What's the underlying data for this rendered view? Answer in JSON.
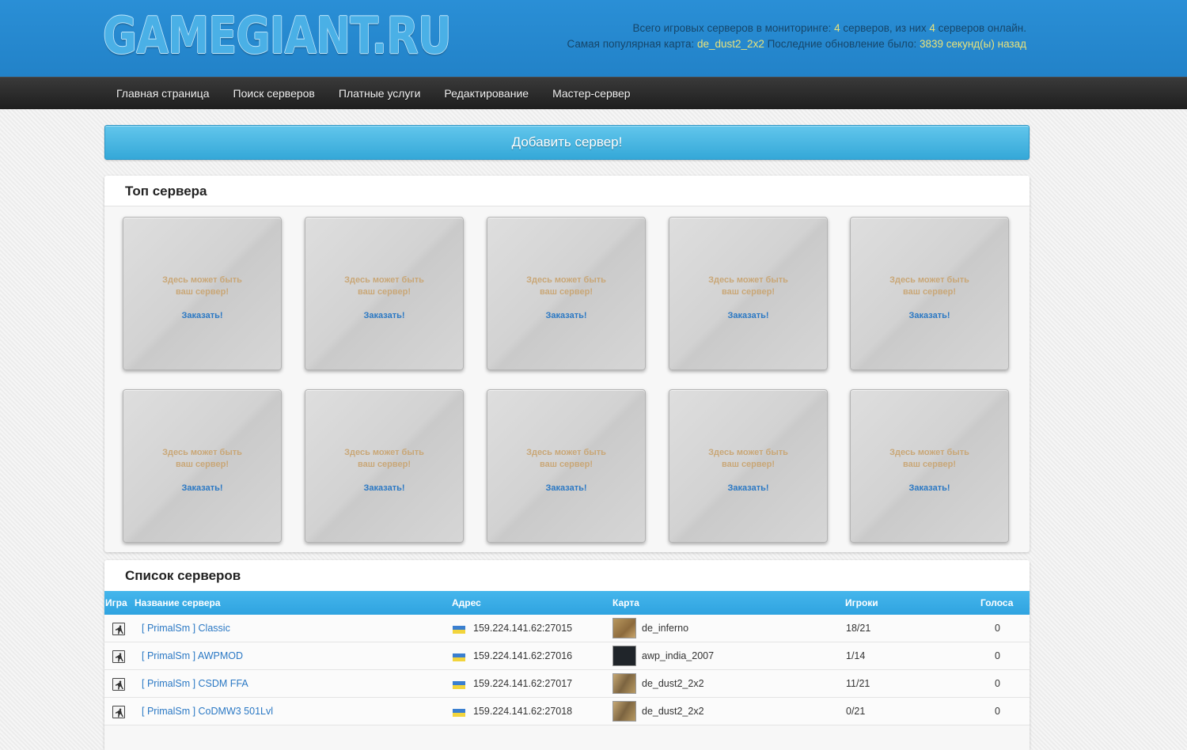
{
  "header": {
    "logo": "GAMEGIANT.RU",
    "stats": {
      "line1_prefix": "Всего игровых серверов в мониторинге:",
      "total": "4",
      "line1_mid": "серверов, из них",
      "online": "4",
      "line1_suffix": "серверов онлайн.",
      "line2_prefix": "Самая популярная карта:",
      "popular_map": "de_dust2_2x2",
      "line2_mid": "Последние обновление было:",
      "last_update": "3839 секунд(ы) назад"
    }
  },
  "nav": {
    "items": [
      {
        "label": "Главная страница"
      },
      {
        "label": "Поиск серверов"
      },
      {
        "label": "Платные услуги"
      },
      {
        "label": "Редактирование"
      },
      {
        "label": "Мастер-сервер"
      }
    ]
  },
  "add_server_label": "Добавить сервер!",
  "top_servers": {
    "title": "Топ сервера",
    "slot_line1": "Здесь может быть",
    "slot_line2": "ваш сервер!",
    "slot_order": "Заказать!",
    "slot_count": 10
  },
  "server_list": {
    "title": "Список серверов",
    "columns": {
      "game": "Игра",
      "name": "Название сервера",
      "address": "Адрес",
      "map": "Карта",
      "players": "Игроки",
      "votes": "Голоса"
    },
    "rows": [
      {
        "game_icon": "counter-strike-icon",
        "name": "[ PrimalSm ] Classic",
        "flag": "ukraine-flag-icon",
        "address": "159.224.141.62:27015",
        "map": "de_inferno",
        "map_thumb": "inferno",
        "players": "18/21",
        "votes": "0"
      },
      {
        "game_icon": "counter-strike-icon",
        "name": "[ PrimalSm ] AWPMOD",
        "flag": "ukraine-flag-icon",
        "address": "159.224.141.62:27016",
        "map": "awp_india_2007",
        "map_thumb": "india",
        "players": "1/14",
        "votes": "0"
      },
      {
        "game_icon": "counter-strike-icon",
        "name": "[ PrimalSm ] CSDM FFA",
        "flag": "ukraine-flag-icon",
        "address": "159.224.141.62:27017",
        "map": "de_dust2_2x2",
        "map_thumb": "dust",
        "players": "11/21",
        "votes": "0"
      },
      {
        "game_icon": "counter-strike-icon",
        "name": "[ PrimalSm ] CoDMW3 501Lvl",
        "flag": "ukraine-flag-icon",
        "address": "159.224.141.62:27018",
        "map": "de_dust2_2x2",
        "map_thumb": "dust",
        "players": "0/21",
        "votes": "0"
      }
    ]
  },
  "colors": {
    "header_blue": "#2282c8",
    "nav_dark": "#2a2a2a",
    "accent_blue": "#34a8d8",
    "highlight_yellow": "#e9e27a",
    "link_blue": "#2a78c4"
  }
}
